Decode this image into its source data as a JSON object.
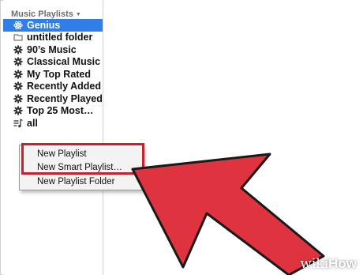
{
  "sidebar": {
    "section_title": "Music Playlists",
    "items": [
      {
        "label": "Genius",
        "icon": "genius-icon",
        "selected": true
      },
      {
        "label": "untitled folder",
        "icon": "folder-icon"
      },
      {
        "label": "90’s Music",
        "icon": "gear-icon"
      },
      {
        "label": "Classical Music",
        "icon": "gear-icon"
      },
      {
        "label": "My Top Rated",
        "icon": "gear-icon"
      },
      {
        "label": "Recently Added",
        "icon": "gear-icon"
      },
      {
        "label": "Recently Played",
        "icon": "gear-icon"
      },
      {
        "label": "Top 25 Most…",
        "icon": "gear-icon"
      },
      {
        "label": "all",
        "icon": "playlist-icon"
      }
    ]
  },
  "context_menu": {
    "items": [
      "New Playlist",
      "New Smart Playlist…",
      "New Playlist Folder"
    ]
  },
  "watermark": {
    "wiki": "wiki",
    "how": "How"
  },
  "colors": {
    "selection": "#2f7fe6",
    "highlight": "#c4222c",
    "arrow": "#e03340"
  }
}
